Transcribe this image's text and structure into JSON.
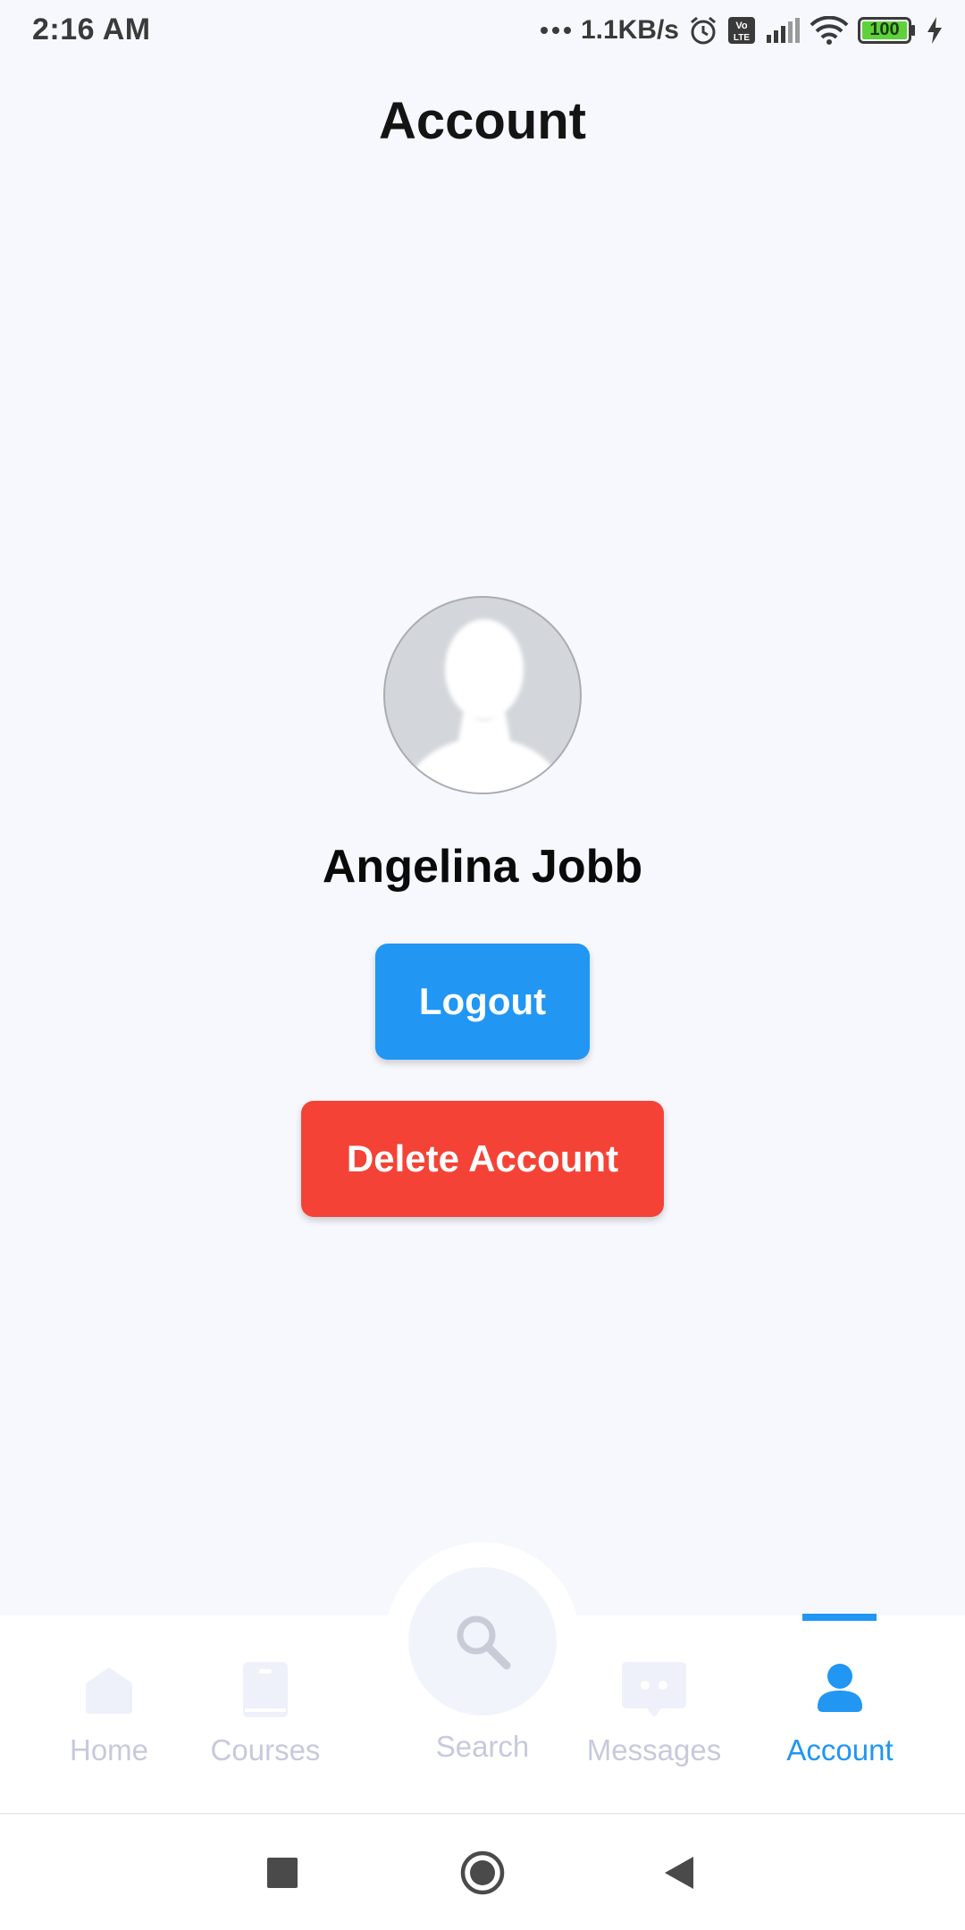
{
  "status_bar": {
    "time": "2:16 AM",
    "network_speed": "1.1KB/s",
    "battery_level": "100",
    "icons": [
      "dots-icon",
      "alarm-icon",
      "volte-icon",
      "signal-icon",
      "wifi-icon",
      "battery-icon",
      "charging-icon"
    ]
  },
  "header": {
    "title": "Account"
  },
  "profile": {
    "name": "Angelina Jobb",
    "avatar_icon": "person-silhouette-icon"
  },
  "actions": {
    "logout_label": "Logout",
    "delete_label": "Delete Account"
  },
  "colors": {
    "primary": "#2196f3",
    "danger": "#f44336",
    "inactive": "#c7c9dd",
    "background": "#f7f8fd"
  },
  "bottom_nav": {
    "active": "Account",
    "items": [
      {
        "label": "Home",
        "icon": "home-icon"
      },
      {
        "label": "Courses",
        "icon": "book-icon"
      },
      {
        "label": "Search",
        "icon": "search-icon"
      },
      {
        "label": "Messages",
        "icon": "chat-icon"
      },
      {
        "label": "Account",
        "icon": "person-icon"
      }
    ]
  },
  "system_nav": {
    "icons": [
      "recents-icon",
      "home-circle-icon",
      "back-icon"
    ]
  }
}
